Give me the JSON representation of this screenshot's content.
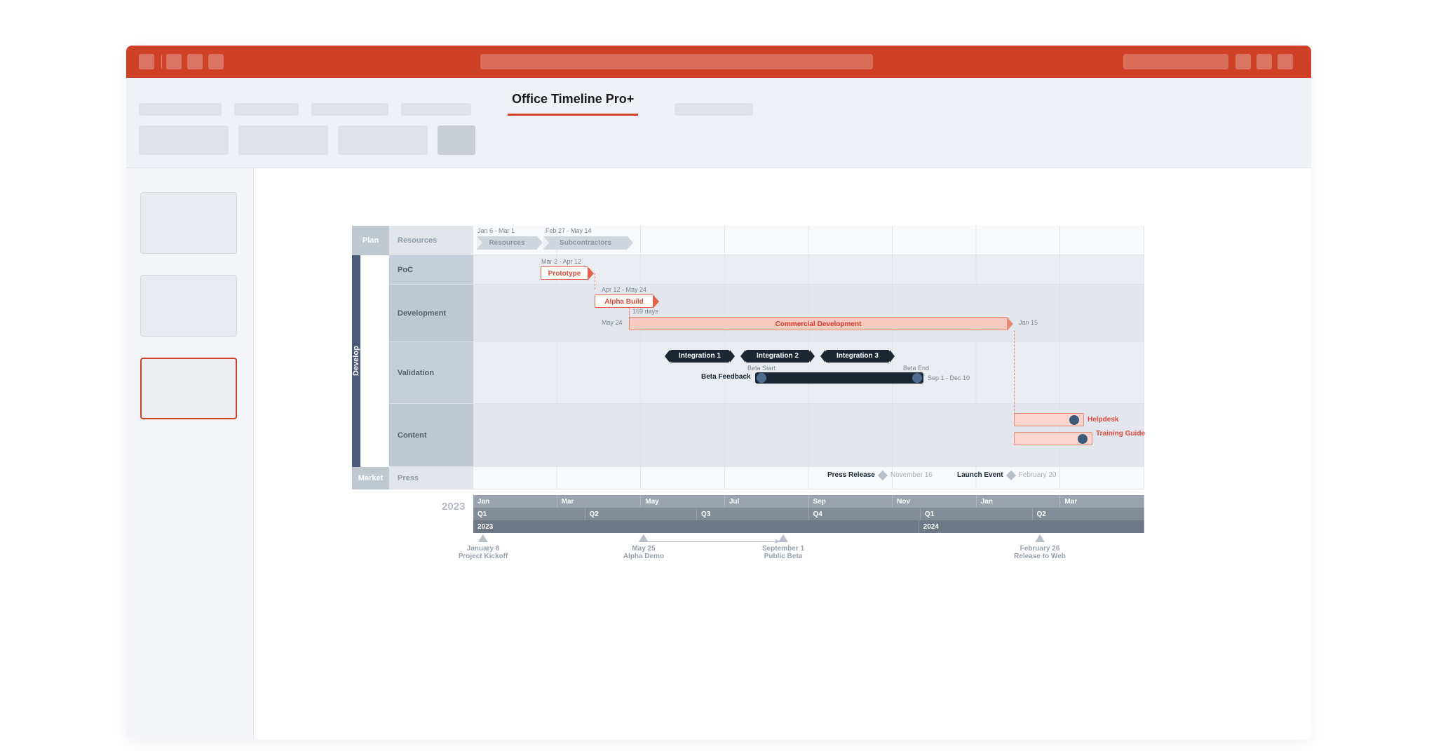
{
  "ribbon": {
    "active_tab": "Office Timeline Pro+"
  },
  "swimlanes": {
    "plan": {
      "cat": "Plan",
      "row": "Resources"
    },
    "develop": {
      "cat": "Develop",
      "rows": {
        "poc": "PoC",
        "dev": "Development",
        "val": "Validation",
        "content": "Content"
      }
    },
    "market": {
      "cat": "Market",
      "row": "Press"
    }
  },
  "plan_row": {
    "r1": {
      "dates": "Jan 6 - Mar 1",
      "label": "Resources"
    },
    "r2": {
      "dates": "Feb 27 - May 14",
      "label": "Subcontractors"
    }
  },
  "poc": {
    "prototype": {
      "dates": "Mar 2 - Apr 12",
      "label": "Prototype"
    }
  },
  "dev": {
    "alpha": {
      "dates": "Apr 12 - May 24",
      "label": "Alpha Build"
    },
    "comm": {
      "duration": "169 days",
      "start": "May 24",
      "end": "Jan 15",
      "label": "Commercial Development"
    }
  },
  "val": {
    "i1": "Integration 1",
    "i2": "Integration 2",
    "i3": "Integration 3",
    "beta_start": "Beta Start",
    "beta_end": "Beta End",
    "beta_label": "Beta Feedback",
    "beta_range": "Sep 1 - Dec 10"
  },
  "content": {
    "helpdesk": "Helpdesk",
    "training": "Training Guide"
  },
  "press": {
    "pr_label": "Press Release",
    "pr_date": "November 16",
    "le_label": "Launch Event",
    "le_date": "February 20"
  },
  "timescale": {
    "months": [
      "Jan",
      "Mar",
      "May",
      "Jul",
      "Sep",
      "Nov",
      "Jan",
      "Mar"
    ],
    "quarters": [
      "Q1",
      "Q2",
      "Q3",
      "Q4",
      "Q1",
      "Q2"
    ],
    "years": [
      "2023",
      "2024"
    ],
    "left_year": "2023",
    "right_year": "2024"
  },
  "milestones": {
    "m1": {
      "date": "January 8",
      "label": "Project Kickoff"
    },
    "m2": {
      "date": "May 25",
      "label": "Alpha Demo"
    },
    "m3": {
      "date": "September 1",
      "label": "Public Beta"
    },
    "m4": {
      "date": "February 26",
      "label": "Release to Web"
    }
  },
  "chart_data": {
    "type": "gantt",
    "x_range": [
      "2023-01-01",
      "2024-06-30"
    ],
    "timescale": {
      "months": [
        "2023-01",
        "2023-03",
        "2023-05",
        "2023-07",
        "2023-09",
        "2023-11",
        "2024-01",
        "2024-03"
      ],
      "quarters": [
        "2023 Q1",
        "2023 Q2",
        "2023 Q3",
        "2023 Q4",
        "2024 Q1",
        "2024 Q2"
      ],
      "years": [
        "2023",
        "2024"
      ]
    },
    "swimlanes": [
      {
        "name": "Plan",
        "faded": true,
        "rows": [
          {
            "name": "Resources",
            "tasks": [
              {
                "name": "Resources",
                "start": "2023-01-06",
                "end": "2023-03-01",
                "style": "chevron-grey"
              },
              {
                "name": "Subcontractors",
                "start": "2023-02-27",
                "end": "2023-05-14",
                "style": "chevron-grey"
              }
            ]
          }
        ]
      },
      {
        "name": "Develop",
        "faded": false,
        "rows": [
          {
            "name": "PoC",
            "tasks": [
              {
                "name": "Prototype",
                "start": "2023-03-02",
                "end": "2023-04-12",
                "style": "red-outline-chevron"
              }
            ]
          },
          {
            "name": "Development",
            "tasks": [
              {
                "name": "Alpha Build",
                "start": "2023-04-12",
                "end": "2023-05-24",
                "style": "red-outline-chevron"
              },
              {
                "name": "Commercial Development",
                "start": "2023-05-24",
                "end": "2024-01-15",
                "duration_days": 169,
                "style": "red-fill-chevron"
              }
            ]
          },
          {
            "name": "Validation",
            "tasks": [
              {
                "name": "Integration 1",
                "start": "2023-06-01",
                "end": "2023-07-10",
                "style": "dark-pill"
              },
              {
                "name": "Integration 2",
                "start": "2023-07-12",
                "end": "2023-08-25",
                "style": "dark-pill"
              },
              {
                "name": "Integration 3",
                "start": "2023-08-28",
                "end": "2023-10-10",
                "style": "dark-pill"
              },
              {
                "name": "Beta Feedback",
                "start": "2023-09-01",
                "end": "2023-12-10",
                "style": "dark-bar-dots",
                "milestones": [
                  {
                    "name": "Beta Start",
                    "date": "2023-09-01"
                  },
                  {
                    "name": "Beta End",
                    "date": "2023-12-10"
                  }
                ]
              }
            ]
          },
          {
            "name": "Content",
            "tasks": [
              {
                "name": "Helpdesk",
                "start": "2024-01-15",
                "end": "2024-02-25",
                "style": "red-box",
                "milestone_dot": "2024-02-10"
              },
              {
                "name": "Training Guide",
                "start": "2024-01-15",
                "end": "2024-03-05",
                "style": "red-box",
                "milestone_dot": "2024-02-25"
              }
            ]
          }
        ]
      },
      {
        "name": "Market",
        "faded": true,
        "rows": [
          {
            "name": "Press",
            "milestones": [
              {
                "name": "Press Release",
                "date": "2023-11-16",
                "style": "diamond-grey"
              },
              {
                "name": "Launch Event",
                "date": "2024-02-20",
                "style": "diamond-grey"
              }
            ]
          }
        ]
      }
    ],
    "bottom_milestones": [
      {
        "name": "Project Kickoff",
        "date": "2023-01-08"
      },
      {
        "name": "Alpha Demo",
        "date": "2023-05-25"
      },
      {
        "name": "Public Beta",
        "date": "2023-09-01"
      },
      {
        "name": "Release to Web",
        "date": "2024-02-26"
      }
    ],
    "dependencies": [
      [
        "Prototype",
        "Alpha Build"
      ],
      [
        "Alpha Build",
        "Commercial Development"
      ],
      [
        "Commercial Development",
        "Helpdesk"
      ],
      [
        "Commercial Development",
        "Training Guide"
      ]
    ]
  }
}
